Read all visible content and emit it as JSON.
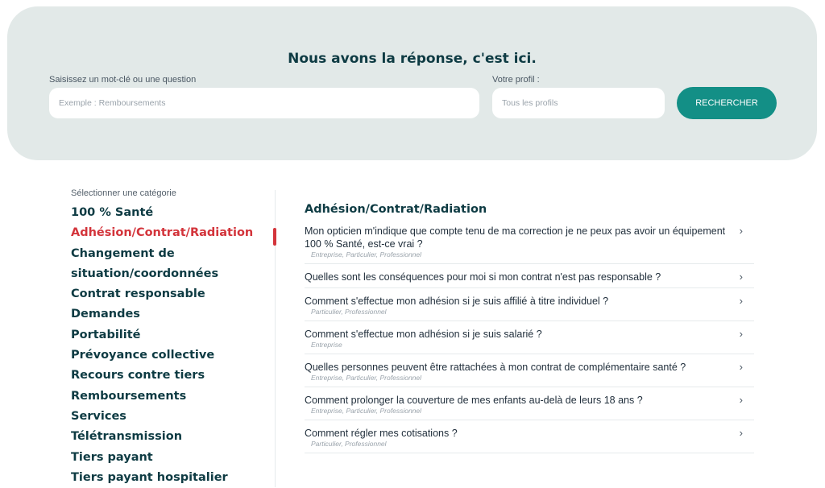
{
  "search": {
    "title": "Nous avons la réponse, c'est ici.",
    "keyword_label": "Saisissez un mot-clé ou une question",
    "keyword_placeholder": "Exemple : Remboursements",
    "profile_label": "Votre profil :",
    "profile_placeholder": "Tous les profils",
    "button_label": "RECHERCHER"
  },
  "sidebar": {
    "label": "Sélectionner une catégorie",
    "categories": [
      "100 % Santé",
      "Adhésion/Contrat/Radiation",
      "Changement de situation/coordonnées",
      "Contrat responsable",
      "Demandes",
      "Portabilité",
      "Prévoyance collective",
      "Recours contre tiers",
      "Remboursements",
      "Services",
      "Télétransmission",
      "Tiers payant",
      "Tiers payant hospitalier"
    ],
    "active": "Adhésion/Contrat/Radiation"
  },
  "content": {
    "title": "Adhésion/Contrat/Radiation",
    "questions": [
      {
        "text": "Mon opticien m'indique que compte tenu de ma correction je ne peux pas avoir un équipement 100 % Santé, est-ce vrai ?",
        "tags": "Entreprise, Particulier, Professionnel"
      },
      {
        "text": "Quelles sont les conséquences pour moi si mon contrat n'est pas responsable ?",
        "tags": ""
      },
      {
        "text": "Comment s'effectue mon adhésion si je suis affilié à titre individuel ?",
        "tags": "Particulier, Professionnel"
      },
      {
        "text": "Comment s'effectue mon adhésion si je suis salarié ?",
        "tags": "Entreprise"
      },
      {
        "text": "Quelles personnes peuvent être rattachées à mon contrat de complémentaire santé ?",
        "tags": "Entreprise, Particulier, Professionnel"
      },
      {
        "text": "Comment prolonger la couverture de mes enfants au-delà de leurs 18 ans ?",
        "tags": "Entreprise, Particulier, Professionnel"
      },
      {
        "text": "Comment régler mes cotisations ?",
        "tags": "Particulier, Professionnel"
      }
    ]
  },
  "icons": {
    "chevron": "›",
    "chevron_name": "chevron-right-icon"
  },
  "colors": {
    "accent": "#138f86",
    "active": "#d3343b",
    "heading": "#0e3b43",
    "hero_bg": "#e2e9e8"
  }
}
